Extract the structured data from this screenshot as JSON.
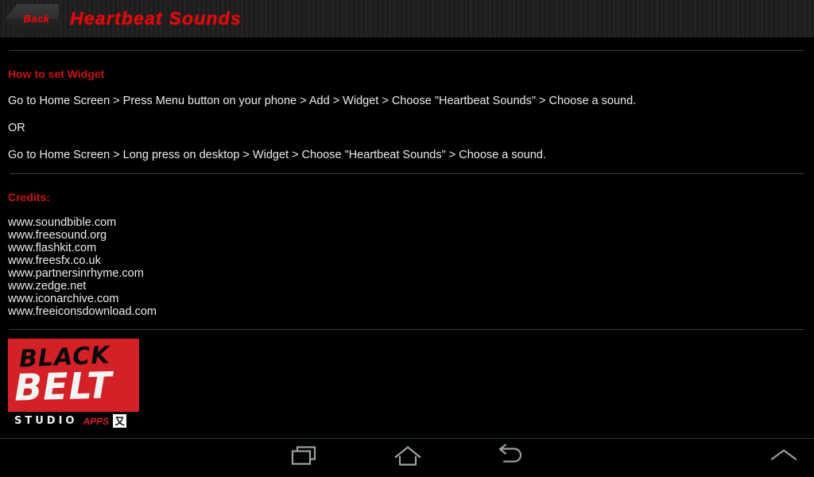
{
  "titlebar": {
    "back_label": "Back",
    "title": "Heartbeat Sounds",
    "title_color": "#e20c0c",
    "back_text_color": "#e01010"
  },
  "content": {
    "widget_section": {
      "heading": "How to set Widget",
      "heading_color": "#cc1111",
      "lines": [
        "Go to Home Screen > Press Menu button on your phone > Add > Widget > Choose \"Heartbeat Sounds\" > Choose a sound.",
        "OR",
        "Go to Home Screen > Long press on desktop > Widget > Choose \"Heartbeat Sounds\" > Choose a sound."
      ]
    },
    "credits_section": {
      "heading": "Credits:",
      "heading_color": "#cc1111",
      "items": [
        "www.soundbible.com",
        "www.freesound.org",
        "www.flashkit.com",
        "www.freesfx.co.uk",
        "www.partnersinrhyme.com",
        "www.zedge.net",
        "www.iconarchive.com",
        "www.freeiconsdownload.com"
      ]
    },
    "logo": {
      "name": "black-belt-studio-apps-logo",
      "word_top": "BLACK",
      "word_main": "BELT",
      "word_studio": "STUDIO",
      "word_apps": "APPS",
      "badge_glyph": "又",
      "red": "#d42128"
    },
    "text_color": "#ececec",
    "divider_color": "#3b3b3b"
  },
  "navbar": {
    "recents_icon": "recents-icon",
    "home_icon": "home-icon",
    "back_icon": "back-icon",
    "expand_icon": "chevron-up-icon",
    "accent_line_color": "#1d3c42"
  }
}
